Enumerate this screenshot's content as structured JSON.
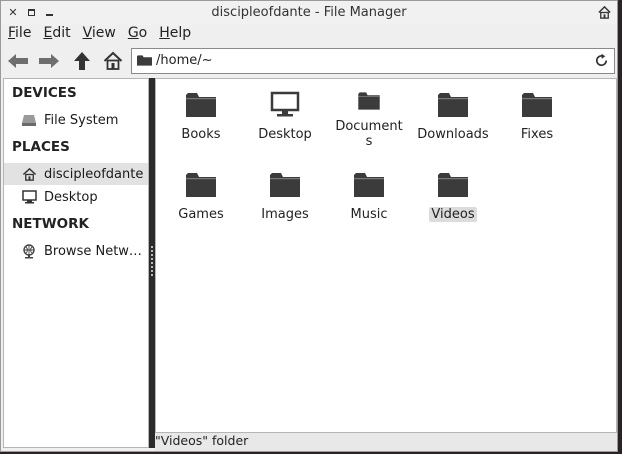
{
  "window": {
    "title": "discipleofdante - File Manager"
  },
  "menubar": [
    {
      "mnemonic": "F",
      "rest": "ile"
    },
    {
      "mnemonic": "E",
      "rest": "dit"
    },
    {
      "mnemonic": "V",
      "rest": "iew"
    },
    {
      "mnemonic": "G",
      "rest": "o"
    },
    {
      "mnemonic": "H",
      "rest": "elp"
    }
  ],
  "toolbar": {
    "back_icon": "back-arrow-icon",
    "forward_icon": "forward-arrow-icon",
    "up_icon": "up-arrow-icon",
    "home_icon": "home-icon",
    "address": "/home/~"
  },
  "sidebar": {
    "devices_heading": "DEVICES",
    "devices": [
      {
        "label": "File System",
        "icon": "drive-icon"
      }
    ],
    "places_heading": "PLACES",
    "places": [
      {
        "label": "discipleofdante",
        "icon": "home-icon",
        "selected": true
      },
      {
        "label": "Desktop",
        "icon": "desktop-icon"
      }
    ],
    "network_heading": "NETWORK",
    "network": [
      {
        "label": "Browse Netw…",
        "icon": "network-icon"
      }
    ]
  },
  "files": [
    {
      "label": "Books",
      "icon": "folder-icon"
    },
    {
      "label": "Desktop",
      "icon": "desktop-icon"
    },
    {
      "label": "Documents",
      "icon": "folder-icon"
    },
    {
      "label": "Downloads",
      "icon": "folder-icon"
    },
    {
      "label": "Fixes",
      "icon": "folder-icon"
    },
    {
      "label": "Games",
      "icon": "folder-icon"
    },
    {
      "label": "Images",
      "icon": "folder-icon"
    },
    {
      "label": "Music",
      "icon": "folder-icon"
    },
    {
      "label": "Videos",
      "icon": "folder-icon",
      "selected": true
    }
  ],
  "status": "\"Videos\" folder"
}
